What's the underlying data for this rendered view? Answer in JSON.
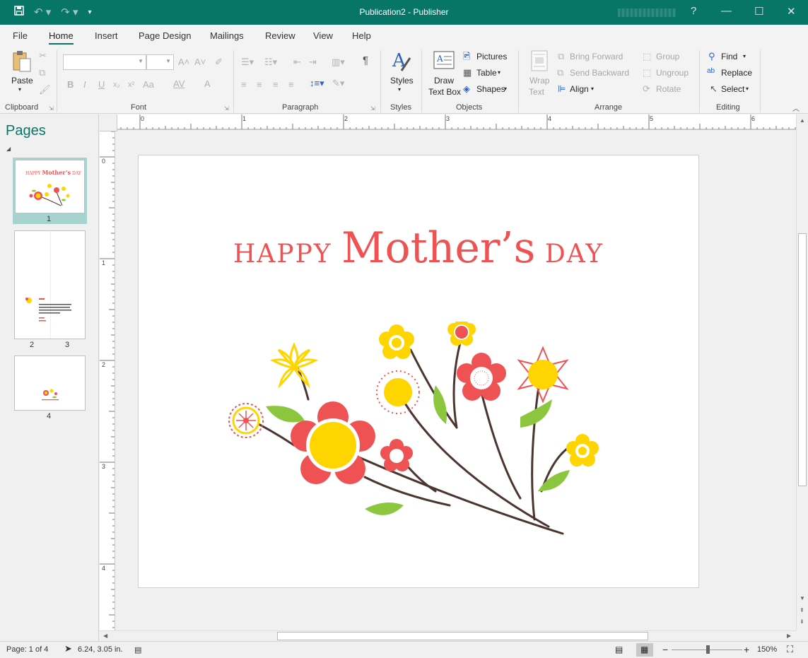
{
  "window": {
    "title": "Publication2 - Publisher",
    "help": "?",
    "minimize": "—",
    "restore": "☐",
    "close": "✕"
  },
  "qat": {
    "save": "💾",
    "undo": "↶ ▾",
    "redo": "↷ ▾",
    "customize": "⩡"
  },
  "tabs": [
    "File",
    "Home",
    "Insert",
    "Page Design",
    "Mailings",
    "Review",
    "View",
    "Help"
  ],
  "active_tab": "Home",
  "ribbon": {
    "clipboard": {
      "paste": "Paste",
      "paste_arrow": "▾",
      "label": "Clipboard"
    },
    "font": {
      "label": "Font",
      "bold": "B",
      "italic": "I",
      "underline": "U",
      "subscript": "x₂",
      "superscript": "x²",
      "change_case": "Aa",
      "char_spacing": "AV",
      "font_color": "A",
      "grow": "A˄",
      "shrink": "A˅",
      "clear": "✐"
    },
    "paragraph": {
      "label": "Paragraph",
      "pilcrow": "¶"
    },
    "styles": {
      "label": "Styles",
      "button": "Styles"
    },
    "objects": {
      "label": "Objects",
      "draw_text_box_1": "Draw",
      "draw_text_box_2": "Text Box",
      "pictures": "Pictures",
      "table": "Table",
      "shapes": "Shapes"
    },
    "arrange": {
      "label": "Arrange",
      "wrap_text_1": "Wrap",
      "wrap_text_2": "Text",
      "bring_forward": "Bring Forward",
      "send_backward": "Send Backward",
      "align": "Align",
      "group": "Group",
      "ungroup": "Ungroup",
      "rotate": "Rotate"
    },
    "editing": {
      "label": "Editing",
      "find": "Find",
      "replace": "Replace",
      "select": "Select"
    }
  },
  "pages_pane": {
    "title": "Pages",
    "thumbs": [
      {
        "label": "1"
      },
      {
        "label_left": "2",
        "label_right": "3"
      },
      {
        "label": "4"
      }
    ]
  },
  "rulers": {
    "horizontal": [
      "0",
      "1",
      "2",
      "3",
      "4",
      "5",
      "6"
    ],
    "vertical": [
      "0",
      "1",
      "2",
      "3",
      "4"
    ]
  },
  "document": {
    "headline_part1": "HAPPY ",
    "headline_part2": "Mother’s",
    "headline_part3": " DAY",
    "accent_color": "#ee5253",
    "yellow": "#ffd500",
    "green": "#8cc63f",
    "stem": "#4a3530"
  },
  "status": {
    "page": "Page: 1 of 4",
    "position": "6.24, 3.05 in.",
    "zoom": "150%",
    "zoom_out": "−",
    "zoom_in": "+"
  },
  "colors": {
    "title_bar": "#077568",
    "accent": "#077568"
  }
}
